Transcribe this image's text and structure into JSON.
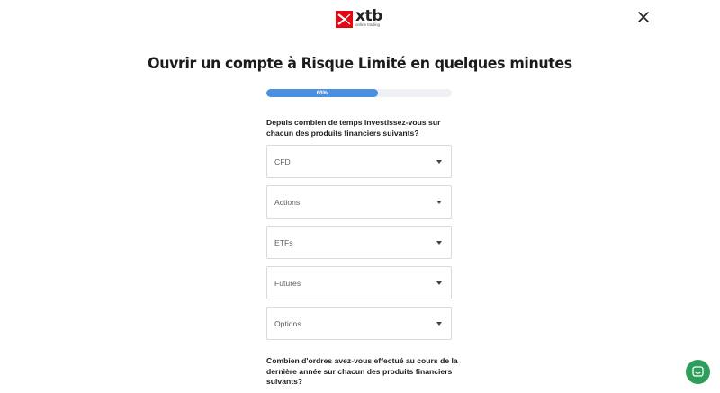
{
  "logo": {
    "name": "xtb",
    "subtitle": "online trading"
  },
  "title": "Ouvrir un compte à Risque Limité en quelques minutes",
  "progress": {
    "label": "60%",
    "value": 0.6
  },
  "question1": "Depuis combien de temps investissez-vous sur chacun des produits financiers suivants?",
  "selects": [
    {
      "label": "CFD"
    },
    {
      "label": "Actions"
    },
    {
      "label": "ETFs"
    },
    {
      "label": "Futures"
    },
    {
      "label": "Options"
    }
  ],
  "question2": "Combien d'ordres avez-vous effectué au cours de la dernière année sur chacun des produits financiers suivants?",
  "icons": {
    "close": "close-icon",
    "dropdown": "chevron-down-icon",
    "chat": "chat-icon"
  },
  "colors": {
    "brand": "#e30613",
    "progress": "#4a90e2",
    "chat": "#2e9e5b"
  }
}
